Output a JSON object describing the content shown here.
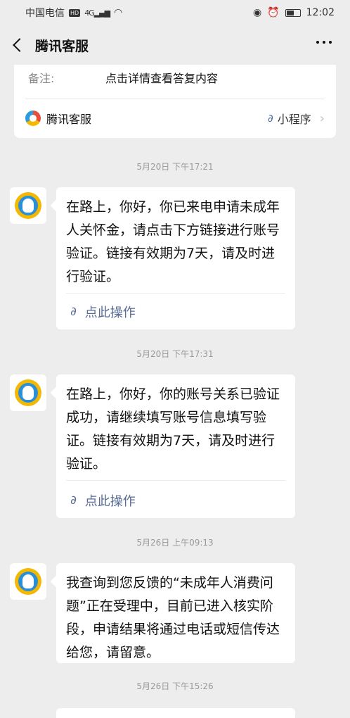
{
  "status_bar": {
    "carrier": "中国电信",
    "hd": "HD",
    "network": "4G",
    "time": "12:02"
  },
  "header": {
    "title": "腾讯客服"
  },
  "card": {
    "note_label": "备注:",
    "note_value": "点击详情查看答复内容",
    "source_name": "腾讯客服",
    "mini_program_label": "小程序"
  },
  "messages": [
    {
      "timestamp": "5月20日 下午17:21",
      "text": "在路上，你好，你已来电申请未成年人关怀金，请点击下方链接进行账号验证。链接有效期为7天，请及时进行验证。",
      "action": "点此操作"
    },
    {
      "timestamp": "5月20日 下午17:31",
      "text": "在路上，你好，你的账号关系已验证成功，请继续填写账号信息填写验证。链接有效期为7天，请及时进行验证。",
      "action": "点此操作"
    },
    {
      "timestamp": "5月26日 上午09:13",
      "text": "我查询到您反馈的“未成年人消费问题”正在受理中，目前已进入核实阶段，申请结果将通过电话或短信传达给您，请留意。",
      "action": ""
    },
    {
      "timestamp": "5月26日 下午15:26",
      "text": "",
      "action": ""
    }
  ]
}
